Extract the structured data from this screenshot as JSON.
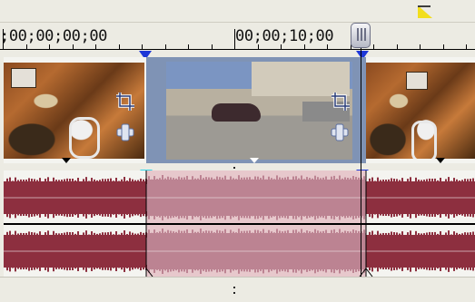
{
  "ruler": {
    "timecode_start": ";00;00;00;00",
    "timecode_mid": "00;00;10;00"
  },
  "colors": {
    "marker_flag": "#f2de1d",
    "selection_video": "#7f93b5",
    "audio_wave": "#8d2f3f",
    "audio_wave_selected": "#bc8392",
    "audio_selection_bg": "#e7c8cc",
    "region_marker": "#1d37d7",
    "fade_marker": "#35d7e8"
  },
  "icons": {
    "crop": "crop-icon",
    "pan": "pan-icon",
    "marker": "marker-flag-icon",
    "playhead": "playhead-handle-icon"
  }
}
